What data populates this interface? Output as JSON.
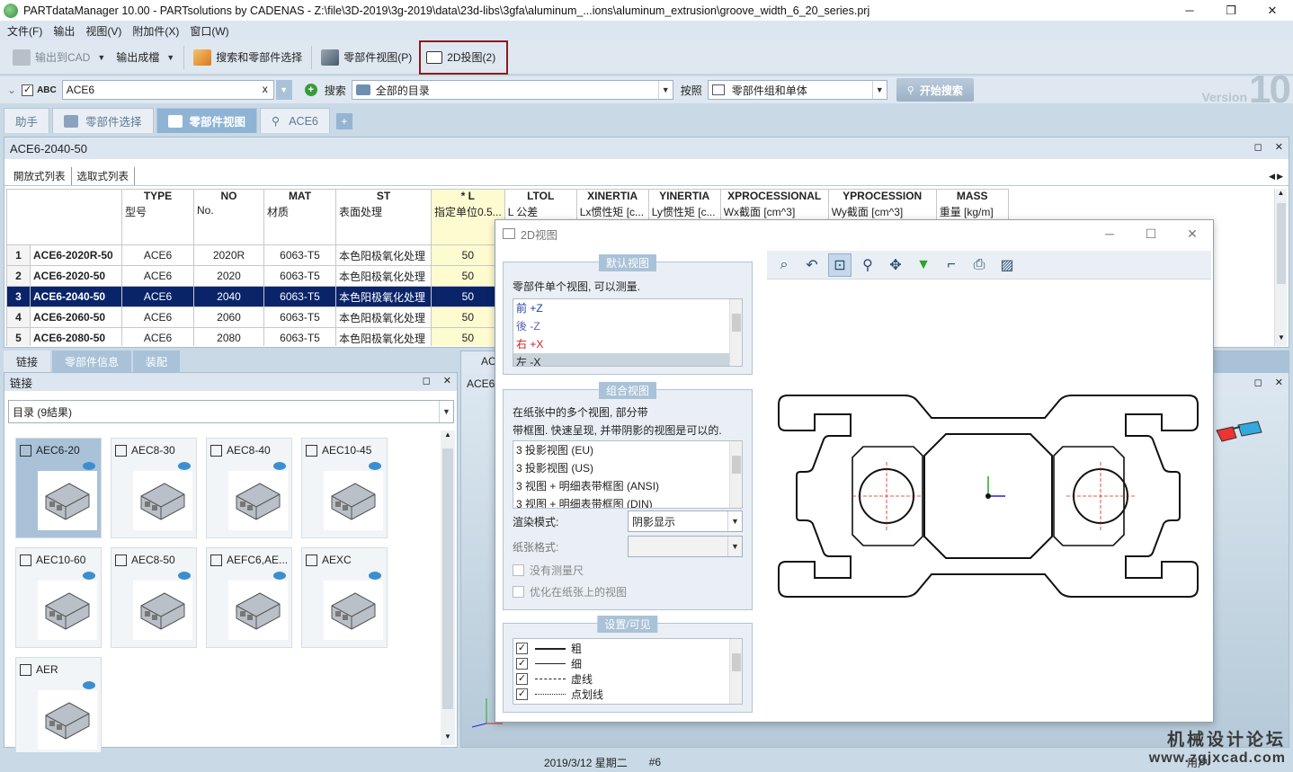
{
  "window": {
    "title": "PARTdataManager 10.00 - PARTsolutions by CADENAS - Z:\\file\\3D-2019\\3g-2019\\data\\23d-libs\\3gfa\\aluminum_...ions\\aluminum_extrusion\\groove_width_6_20_series.prj",
    "minimize": "─",
    "maximize": "❐",
    "close": "✕"
  },
  "menu": [
    "文件(F)",
    "输出",
    "视图(V)",
    "附加件(X)",
    "窗口(W)"
  ],
  "toolbar": {
    "export_cad": "输出到CAD",
    "export_doc": "输出成檔",
    "search_select": "搜索和零部件选择",
    "part_view": "零部件视图(P)",
    "view_2d": "2D投图(2)"
  },
  "search": {
    "abc": "ABC",
    "query": "ACE6",
    "clear": "x",
    "search_label": "搜索",
    "catalog": "全部的目录",
    "by_label": "按照",
    "scope": "零部件组和单体",
    "go": "开始搜索"
  },
  "version": {
    "text": "Version",
    "num": "10"
  },
  "tabs": [
    {
      "label": "助手"
    },
    {
      "label": "零部件选择"
    },
    {
      "label": "零部件视图"
    },
    {
      "label": "ACE6"
    }
  ],
  "tab_plus": "+",
  "part_panel": {
    "title": "ACE6-2040-50",
    "subtabs": [
      "開放式列表",
      "选取式列表"
    ],
    "ctrl_max": "◻",
    "ctrl_close": "✕",
    "scroll_left": "◀",
    "scroll_right": "▶"
  },
  "table": {
    "headers": [
      {
        "code": "",
        "sub": ""
      },
      {
        "code": "TYPE",
        "sub": "型号"
      },
      {
        "code": "NO",
        "sub": "No."
      },
      {
        "code": "MAT",
        "sub": "材质"
      },
      {
        "code": "ST",
        "sub": "表面处理"
      },
      {
        "code": "* L",
        "sub": "指定单位0.5..."
      },
      {
        "code": "LTOL",
        "sub": "L 公差"
      },
      {
        "code": "XINERTIA",
        "sub": "Lx惯性矩 [c..."
      },
      {
        "code": "YINERTIA",
        "sub": "Ly惯性矩 [c..."
      },
      {
        "code": "XPROCESSIONAL",
        "sub": "Wx截面 [cm^3]"
      },
      {
        "code": "YPROCESSION",
        "sub": "Wy截面 [cm^3]"
      },
      {
        "code": "MASS",
        "sub": "重量 [kg/m]"
      }
    ],
    "rows": [
      {
        "n": "1",
        "name": "ACE6-2020R-50",
        "type": "ACE6",
        "no": "2020R",
        "mat": "6063-T5",
        "st": "本色阳极氧化处理",
        "l": "50"
      },
      {
        "n": "2",
        "name": "ACE6-2020-50",
        "type": "ACE6",
        "no": "2020",
        "mat": "6063-T5",
        "st": "本色阳极氧化处理",
        "l": "50"
      },
      {
        "n": "3",
        "name": "ACE6-2040-50",
        "type": "ACE6",
        "no": "2040",
        "mat": "6063-T5",
        "st": "本色阳极氧化处理",
        "l": "50"
      },
      {
        "n": "4",
        "name": "ACE6-2060-50",
        "type": "ACE6",
        "no": "2060",
        "mat": "6063-T5",
        "st": "本色阳极氧化处理",
        "l": "50"
      },
      {
        "n": "5",
        "name": "ACE6-2080-50",
        "type": "ACE6",
        "no": "2080",
        "mat": "6063-T5",
        "st": "本色阳极氧化处理",
        "l": "50"
      }
    ],
    "selected_index": 2
  },
  "lower_tabs": [
    "链接",
    "零部件信息",
    "装配"
  ],
  "links": {
    "title": "链接",
    "catalog": "目录 (9結果)",
    "items": [
      {
        "label": "AEC6-20"
      },
      {
        "label": "AEC8-30"
      },
      {
        "label": "AEC8-40"
      },
      {
        "label": "AEC10-45"
      },
      {
        "label": "AEC10-60"
      },
      {
        "label": "AEC8-50"
      },
      {
        "label": "AEFC6,AE..."
      },
      {
        "label": "AEXC"
      },
      {
        "label": "AER"
      }
    ]
  },
  "viewer3d": {
    "tab": "AC",
    "title": "ACE6"
  },
  "dialog": {
    "title": "2D视图",
    "default_views": {
      "title": "默认视图",
      "desc": "零部件单个视图, 可以测量.",
      "items": [
        "前 +Z",
        "後 -Z",
        "右 +X",
        "左 -X"
      ],
      "item_colors": [
        "#1f3fa5",
        "#5a64b4",
        "#d02020",
        "#222222"
      ]
    },
    "combo_views": {
      "title": "组合视图",
      "desc1": "在纸张中的多个视图, 部分带",
      "desc2": "带框图. 快速呈现, 并带阴影的视图是可以的.",
      "items": [
        "3 投影视图 (EU)",
        "3 投影视图 (US)",
        "3 视图 + 明细表带框图 (ANSI)",
        "3 视图 + 明细表带框图 (DIN)"
      ],
      "render_label": "渲染模式:",
      "render_value": "阴影显示",
      "paper_label": "纸张格式:",
      "paper_value": "",
      "opt_no_dims": "没有测量尺",
      "opt_optimize": "优化在纸张上的视图"
    },
    "visibility": {
      "title": "设置/可见",
      "items": [
        {
          "label": "粗",
          "style": "solid-thick"
        },
        {
          "label": "细",
          "style": "solid-thin"
        },
        {
          "label": "虚线",
          "style": "dashed"
        },
        {
          "label": "点划线",
          "style": "dashdot"
        }
      ]
    }
  },
  "status": {
    "date": "2019/3/12 星期二",
    "num": "#6",
    "user": "用户"
  },
  "watermark": {
    "line1": "机械设计论坛",
    "line2": "www.zgjxcad.com"
  },
  "colors": {
    "selection": "#0a246a",
    "highlight_col": "#fffbd0",
    "accent": "#8fb3d4",
    "frame_red": "#8b1c1c"
  }
}
